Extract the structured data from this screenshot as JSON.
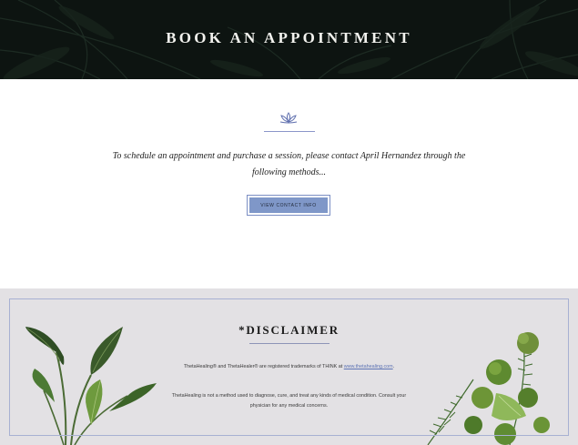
{
  "hero": {
    "title": "BOOK AN APPOINTMENT"
  },
  "intro": {
    "line1": "To schedule an appointment and purchase a session, please contact April Hernandez through the",
    "line2": "following methods...",
    "button_label": "VIEW CONTACT INFO"
  },
  "disclaimer": {
    "title": "*DISCLAIMER",
    "trademark_text": "ThetaHealing® and ThetaHealer® are registered trademarks of THINK at",
    "trademark_link": "www.thetahealing.com",
    "trademark_end": ".",
    "notice_line1": "ThetaHealing is not a method used to diagnose, cure, and treat any kinds of medical condition. Consult your",
    "notice_line2": "physician for any medical concerns."
  },
  "colors": {
    "hero_bg": "#0d1411",
    "button_bg": "#7f97c8",
    "accent_rule": "#8b96c9",
    "disclaimer_bg": "#e3e1e4"
  },
  "icons": {
    "lotus": "lotus-icon",
    "left_plant": "bird-of-paradise-leaves",
    "right_plant": "fern-and-bouquet"
  }
}
